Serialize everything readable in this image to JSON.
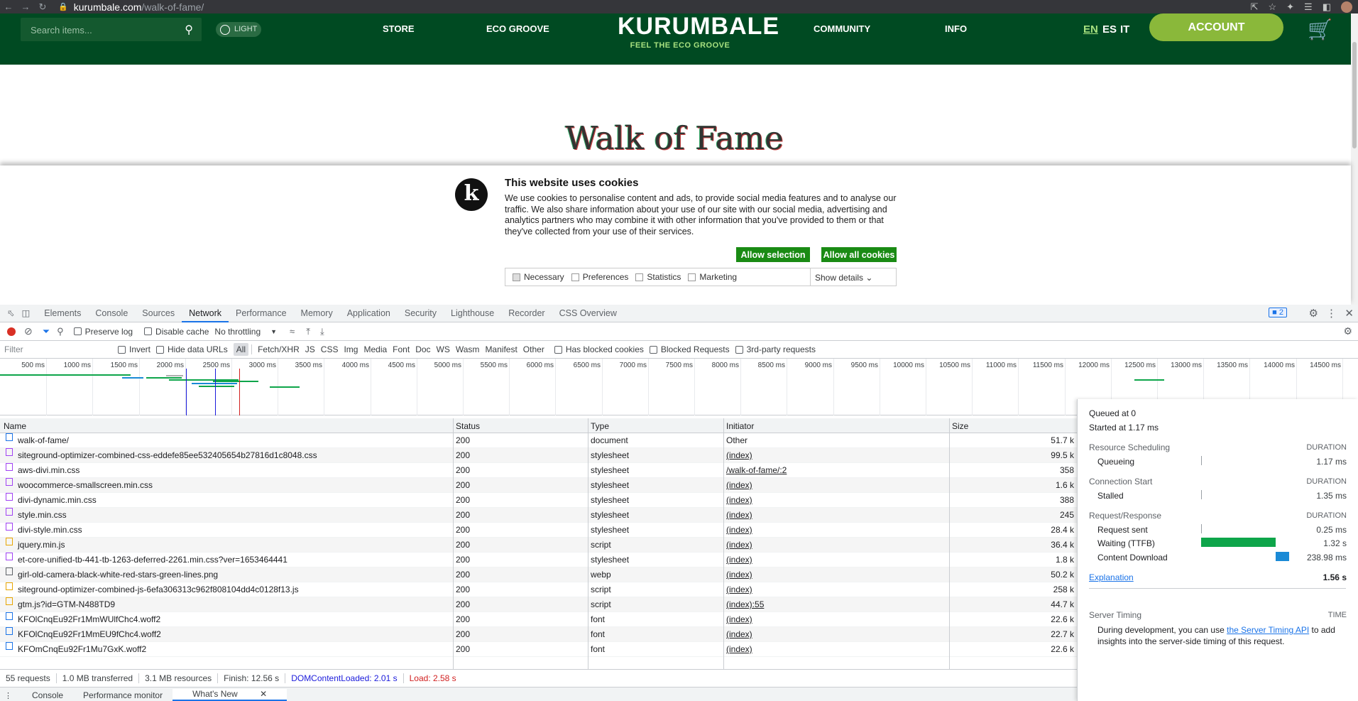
{
  "browser": {
    "url_host": "kurumbale.com",
    "url_path": "/walk-of-fame/"
  },
  "site": {
    "search_placeholder": "Search items...",
    "theme_toggle": "LIGHT",
    "nav": [
      "STORE",
      "ECO GROOVE",
      "COMMUNITY",
      "INFO"
    ],
    "logo": "KURUMBALE",
    "tagline": "FEEL THE ECO GROOVE",
    "languages": [
      "EN",
      "ES",
      "IT"
    ],
    "account": "ACCOUNT",
    "page_title": "Walk of Fame"
  },
  "cookie": {
    "title": "This website uses cookies",
    "text": "We use cookies to personalise content and ads, to provide social media features and to analyse our traffic. We also share information about your use of our site with our social media, advertising and analytics partners who may combine it with other information that you've provided to them or that they've collected from your use of their services.",
    "allow_selection": "Allow selection",
    "allow_all": "Allow all cookies",
    "options": [
      "Necessary",
      "Preferences",
      "Statistics",
      "Marketing"
    ],
    "show_details": "Show details",
    "logo_letter": "k"
  },
  "devtools": {
    "tabs": [
      "Elements",
      "Console",
      "Sources",
      "Network",
      "Performance",
      "Memory",
      "Application",
      "Security",
      "Lighthouse",
      "Recorder",
      "CSS Overview"
    ],
    "active_tab": "Network",
    "issues_count": "2",
    "toolbar": {
      "preserve_log": "Preserve log",
      "disable_cache": "Disable cache",
      "throttling": "No throttling"
    },
    "filter": {
      "placeholder": "Filter",
      "invert": "Invert",
      "hide_data_urls": "Hide data URLs",
      "types": [
        "All",
        "Fetch/XHR",
        "JS",
        "CSS",
        "Img",
        "Media",
        "Font",
        "Doc",
        "WS",
        "Wasm",
        "Manifest",
        "Other"
      ],
      "has_blocked_cookies": "Has blocked cookies",
      "blocked_requests": "Blocked Requests",
      "third_party": "3rd-party requests"
    },
    "timeline_ticks": [
      "500 ms",
      "1000 ms",
      "1500 ms",
      "2000 ms",
      "2500 ms",
      "3000 ms",
      "3500 ms",
      "4000 ms",
      "4500 ms",
      "5000 ms",
      "5500 ms",
      "6000 ms",
      "6500 ms",
      "7000 ms",
      "7500 ms",
      "8000 ms",
      "8500 ms",
      "9000 ms",
      "9500 ms",
      "10000 ms",
      "10500 ms",
      "11000 ms",
      "11500 ms",
      "12000 ms",
      "12500 ms",
      "13000 ms",
      "13500 ms",
      "14000 ms",
      "14500 ms"
    ],
    "columns": [
      "Name",
      "Status",
      "Type",
      "Initiator",
      "Size"
    ],
    "rows": [
      {
        "name": "walk-of-fame/",
        "status": "200",
        "type": "document",
        "initiator": "Other",
        "size": "51.7 k",
        "kind": "doc"
      },
      {
        "name": "siteground-optimizer-combined-css-eddefe85ee532405654b27816d1c8048.css",
        "status": "200",
        "type": "stylesheet",
        "initiator": "(index)",
        "size": "99.5 k",
        "kind": "css"
      },
      {
        "name": "aws-divi.min.css",
        "status": "200",
        "type": "stylesheet",
        "initiator": "/walk-of-fame/:2",
        "size": "358",
        "kind": "css"
      },
      {
        "name": "woocommerce-smallscreen.min.css",
        "status": "200",
        "type": "stylesheet",
        "initiator": "(index)",
        "size": "1.6 k",
        "kind": "css"
      },
      {
        "name": "divi-dynamic.min.css",
        "status": "200",
        "type": "stylesheet",
        "initiator": "(index)",
        "size": "388",
        "kind": "css"
      },
      {
        "name": "style.min.css",
        "status": "200",
        "type": "stylesheet",
        "initiator": "(index)",
        "size": "245",
        "kind": "css"
      },
      {
        "name": "divi-style.min.css",
        "status": "200",
        "type": "stylesheet",
        "initiator": "(index)",
        "size": "28.4 k",
        "kind": "css"
      },
      {
        "name": "jquery.min.js",
        "status": "200",
        "type": "script",
        "initiator": "(index)",
        "size": "36.4 k",
        "kind": "js"
      },
      {
        "name": "et-core-unified-tb-441-tb-1263-deferred-2261.min.css?ver=1653464441",
        "status": "200",
        "type": "stylesheet",
        "initiator": "(index)",
        "size": "1.8 k",
        "kind": "css"
      },
      {
        "name": "girl-old-camera-black-white-red-stars-green-lines.png",
        "status": "200",
        "type": "webp",
        "initiator": "(index)",
        "size": "50.2 k",
        "kind": "img"
      },
      {
        "name": "siteground-optimizer-combined-js-6efa306313c962f808104dd4c0128f13.js",
        "status": "200",
        "type": "script",
        "initiator": "(index)",
        "size": "258 k",
        "kind": "js"
      },
      {
        "name": "gtm.js?id=GTM-N488TD9",
        "status": "200",
        "type": "script",
        "initiator": "(index):55",
        "size": "44.7 k",
        "kind": "js"
      },
      {
        "name": "KFOlCnqEu92Fr1MmWUlfChc4.woff2",
        "status": "200",
        "type": "font",
        "initiator": "(index)",
        "size": "22.6 k",
        "kind": "font"
      },
      {
        "name": "KFOlCnqEu92Fr1MmEU9fChc4.woff2",
        "status": "200",
        "type": "font",
        "initiator": "(index)",
        "size": "22.7 k",
        "kind": "font"
      },
      {
        "name": "KFOmCnqEu92Fr1Mu7GxK.woff2",
        "status": "200",
        "type": "font",
        "initiator": "(index)",
        "size": "22.6 k",
        "kind": "font"
      }
    ],
    "status_bar": {
      "requests": "55 requests",
      "transferred": "1.0 MB transferred",
      "resources": "3.1 MB resources",
      "finish": "Finish: 12.56 s",
      "dcl": "DOMContentLoaded: 2.01 s",
      "load": "Load: 2.58 s"
    },
    "drawer_tabs": [
      "Console",
      "Performance monitor",
      "What's New"
    ],
    "timing": {
      "queued_at": "Queued at 0",
      "started_at": "Started at 1.17 ms",
      "resource_scheduling": "Resource Scheduling",
      "duration": "DURATION",
      "queueing_label": "Queueing",
      "queueing": "1.17 ms",
      "connection_start": "Connection Start",
      "stalled_label": "Stalled",
      "stalled": "1.35 ms",
      "request_response": "Request/Response",
      "request_sent_label": "Request sent",
      "request_sent": "0.25 ms",
      "waiting_label": "Waiting (TTFB)",
      "waiting": "1.32 s",
      "download_label": "Content Download",
      "download": "238.98 ms",
      "explanation": "Explanation",
      "total": "1.56 s",
      "server_timing": "Server Timing",
      "time": "TIME",
      "server_text_1": "During development, you can use",
      "server_link": "the Server Timing API",
      "server_text_2": "to add insights into the server-side timing of this request."
    },
    "colors": {
      "waiting": "#0ea54a",
      "download": "#1a8ad6",
      "dcl": "#1a1adb",
      "load": "#d12020"
    }
  }
}
